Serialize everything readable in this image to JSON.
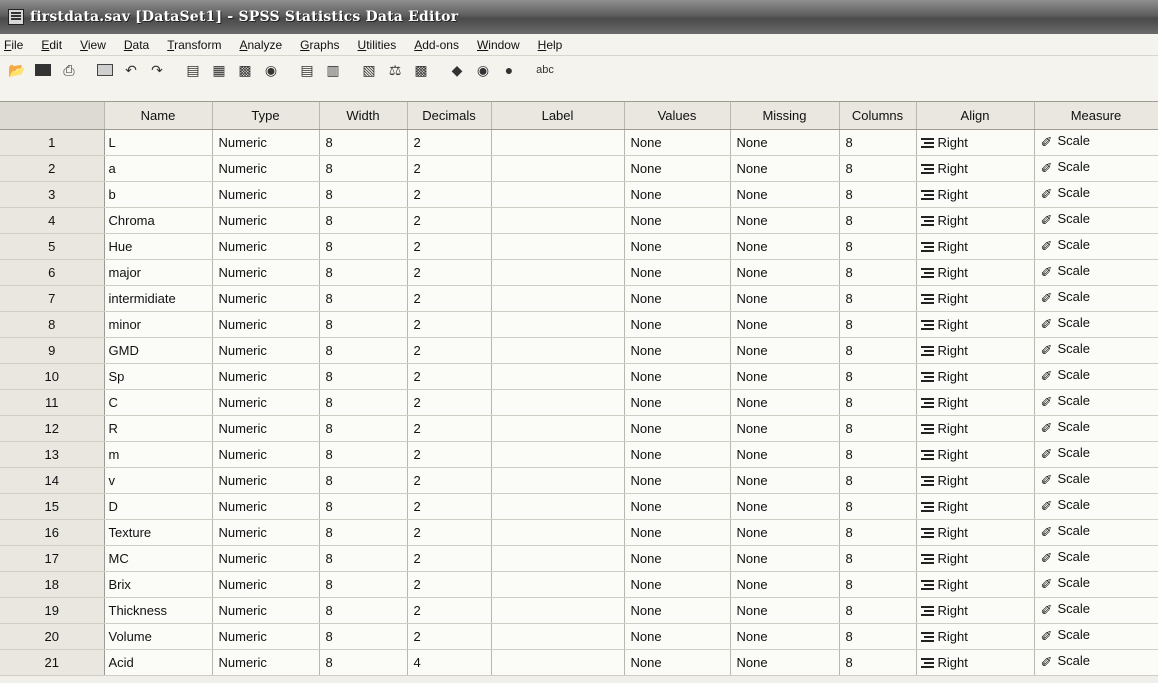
{
  "window": {
    "title": "firstdata.sav [DataSet1] - SPSS Statistics Data Editor"
  },
  "menu": [
    "File",
    "Edit",
    "View",
    "Data",
    "Transform",
    "Analyze",
    "Graphs",
    "Utilities",
    "Add-ons",
    "Window",
    "Help"
  ],
  "toolbar": {
    "icons": [
      "open-folder-icon",
      "save-icon",
      "print-icon",
      "dialog-recall-icon",
      "undo-icon",
      "redo-icon",
      "goto-case-icon",
      "goto-variable-icon",
      "variables-icon",
      "find-icon",
      "insert-cases-icon",
      "insert-variable-icon",
      "split-file-icon",
      "weight-cases-icon",
      "select-cases-icon",
      "value-labels-icon",
      "use-sets-icon",
      "show-all-variables-icon",
      "spell-check-icon"
    ]
  },
  "columns": [
    "",
    "Name",
    "Type",
    "Width",
    "Decimals",
    "Label",
    "Values",
    "Missing",
    "Columns",
    "Align",
    "Measure"
  ],
  "rows": [
    {
      "n": "1",
      "name": "L",
      "type": "Numeric",
      "width": "8",
      "decimals": "2",
      "label": "",
      "values": "None",
      "missing": "None",
      "columns": "8",
      "align": "Right",
      "measure": "Scale"
    },
    {
      "n": "2",
      "name": "a",
      "type": "Numeric",
      "width": "8",
      "decimals": "2",
      "label": "",
      "values": "None",
      "missing": "None",
      "columns": "8",
      "align": "Right",
      "measure": "Scale"
    },
    {
      "n": "3",
      "name": "b",
      "type": "Numeric",
      "width": "8",
      "decimals": "2",
      "label": "",
      "values": "None",
      "missing": "None",
      "columns": "8",
      "align": "Right",
      "measure": "Scale"
    },
    {
      "n": "4",
      "name": "Chroma",
      "type": "Numeric",
      "width": "8",
      "decimals": "2",
      "label": "",
      "values": "None",
      "missing": "None",
      "columns": "8",
      "align": "Right",
      "measure": "Scale"
    },
    {
      "n": "5",
      "name": "Hue",
      "type": "Numeric",
      "width": "8",
      "decimals": "2",
      "label": "",
      "values": "None",
      "missing": "None",
      "columns": "8",
      "align": "Right",
      "measure": "Scale"
    },
    {
      "n": "6",
      "name": "major",
      "type": "Numeric",
      "width": "8",
      "decimals": "2",
      "label": "",
      "values": "None",
      "missing": "None",
      "columns": "8",
      "align": "Right",
      "measure": "Scale"
    },
    {
      "n": "7",
      "name": "intermidiate",
      "type": "Numeric",
      "width": "8",
      "decimals": "2",
      "label": "",
      "values": "None",
      "missing": "None",
      "columns": "8",
      "align": "Right",
      "measure": "Scale"
    },
    {
      "n": "8",
      "name": "minor",
      "type": "Numeric",
      "width": "8",
      "decimals": "2",
      "label": "",
      "values": "None",
      "missing": "None",
      "columns": "8",
      "align": "Right",
      "measure": "Scale"
    },
    {
      "n": "9",
      "name": "GMD",
      "type": "Numeric",
      "width": "8",
      "decimals": "2",
      "label": "",
      "values": "None",
      "missing": "None",
      "columns": "8",
      "align": "Right",
      "measure": "Scale"
    },
    {
      "n": "10",
      "name": "Sp",
      "type": "Numeric",
      "width": "8",
      "decimals": "2",
      "label": "",
      "values": "None",
      "missing": "None",
      "columns": "8",
      "align": "Right",
      "measure": "Scale"
    },
    {
      "n": "11",
      "name": "C",
      "type": "Numeric",
      "width": "8",
      "decimals": "2",
      "label": "",
      "values": "None",
      "missing": "None",
      "columns": "8",
      "align": "Right",
      "measure": "Scale"
    },
    {
      "n": "12",
      "name": "R",
      "type": "Numeric",
      "width": "8",
      "decimals": "2",
      "label": "",
      "values": "None",
      "missing": "None",
      "columns": "8",
      "align": "Right",
      "measure": "Scale"
    },
    {
      "n": "13",
      "name": "m",
      "type": "Numeric",
      "width": "8",
      "decimals": "2",
      "label": "",
      "values": "None",
      "missing": "None",
      "columns": "8",
      "align": "Right",
      "measure": "Scale"
    },
    {
      "n": "14",
      "name": "v",
      "type": "Numeric",
      "width": "8",
      "decimals": "2",
      "label": "",
      "values": "None",
      "missing": "None",
      "columns": "8",
      "align": "Right",
      "measure": "Scale"
    },
    {
      "n": "15",
      "name": "D",
      "type": "Numeric",
      "width": "8",
      "decimals": "2",
      "label": "",
      "values": "None",
      "missing": "None",
      "columns": "8",
      "align": "Right",
      "measure": "Scale"
    },
    {
      "n": "16",
      "name": "Texture",
      "type": "Numeric",
      "width": "8",
      "decimals": "2",
      "label": "",
      "values": "None",
      "missing": "None",
      "columns": "8",
      "align": "Right",
      "measure": "Scale"
    },
    {
      "n": "17",
      "name": "MC",
      "type": "Numeric",
      "width": "8",
      "decimals": "2",
      "label": "",
      "values": "None",
      "missing": "None",
      "columns": "8",
      "align": "Right",
      "measure": "Scale"
    },
    {
      "n": "18",
      "name": "Brix",
      "type": "Numeric",
      "width": "8",
      "decimals": "2",
      "label": "",
      "values": "None",
      "missing": "None",
      "columns": "8",
      "align": "Right",
      "measure": "Scale"
    },
    {
      "n": "19",
      "name": "Thickness",
      "type": "Numeric",
      "width": "8",
      "decimals": "2",
      "label": "",
      "values": "None",
      "missing": "None",
      "columns": "8",
      "align": "Right",
      "measure": "Scale"
    },
    {
      "n": "20",
      "name": "Volume",
      "type": "Numeric",
      "width": "8",
      "decimals": "2",
      "label": "",
      "values": "None",
      "missing": "None",
      "columns": "8",
      "align": "Right",
      "measure": "Scale"
    },
    {
      "n": "21",
      "name": "Acid",
      "type": "Numeric",
      "width": "8",
      "decimals": "4",
      "label": "",
      "values": "None",
      "missing": "None",
      "columns": "8",
      "align": "Right",
      "measure": "Scale"
    }
  ]
}
